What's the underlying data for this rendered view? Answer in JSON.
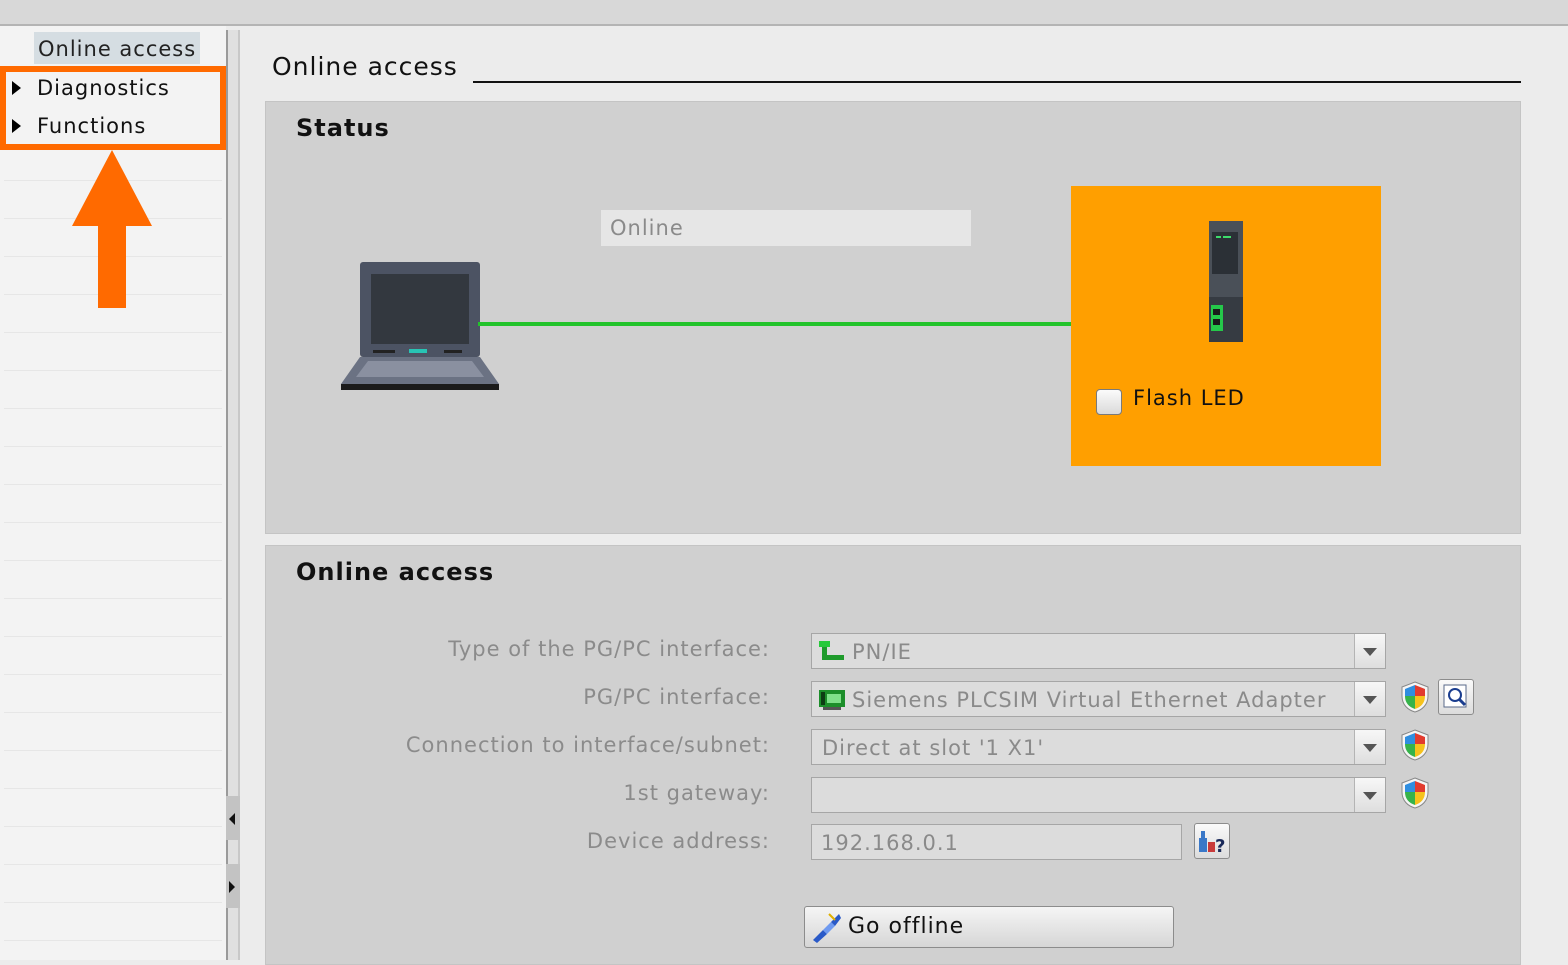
{
  "nav": {
    "header": "Online access",
    "items": [
      {
        "label": "Diagnostics"
      },
      {
        "label": "Functions"
      }
    ]
  },
  "main": {
    "title": "Online access",
    "status": {
      "title": "Status",
      "connection_state": "Online",
      "flash_led_label": "Flash LED",
      "flash_led_checked": false
    },
    "access": {
      "title": "Online access",
      "fields": [
        {
          "label": "Type of the PG/PC interface:",
          "value": "PN/IE",
          "icon": "ethernet-icon"
        },
        {
          "label": "PG/PC interface:",
          "value": "Siemens PLCSIM Virtual Ethernet Adapter",
          "icon": "network-card-icon"
        },
        {
          "label": "Connection to interface/subnet:",
          "value": "Direct at slot '1 X1'"
        },
        {
          "label": "1st gateway:",
          "value": ""
        },
        {
          "label": "Device address:",
          "value": "192.168.0.1"
        }
      ],
      "go_offline_label": "Go offline"
    }
  },
  "colors": {
    "highlight": "#ff6a00",
    "device_box": "#ff9f00",
    "link_online": "#22c32b"
  }
}
